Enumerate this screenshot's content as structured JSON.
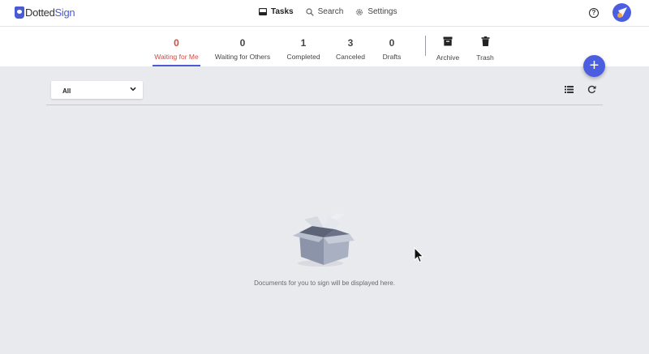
{
  "app": {
    "logo_prefix": "Dotted",
    "logo_suffix": "Sign"
  },
  "topnav": [
    {
      "label": "Tasks",
      "icon": "inbox-icon",
      "active": true
    },
    {
      "label": "Search",
      "icon": "search-icon",
      "active": false
    },
    {
      "label": "Settings",
      "icon": "gear-icon",
      "active": false
    }
  ],
  "header": {
    "help_icon": "help-icon",
    "avatar": "user-avatar"
  },
  "tabs": [
    {
      "count": "0",
      "label": "Waiting for Me",
      "active": true
    },
    {
      "count": "0",
      "label": "Waiting for Others",
      "active": false
    },
    {
      "count": "1",
      "label": "Completed",
      "active": false
    },
    {
      "count": "3",
      "label": "Canceled",
      "active": false
    },
    {
      "count": "0",
      "label": "Drafts",
      "active": false
    },
    {
      "label": "Archive",
      "icon": "archive-icon"
    },
    {
      "label": "Trash",
      "icon": "trash-icon"
    }
  ],
  "fab": {
    "label": "+"
  },
  "filter": {
    "selected": "All"
  },
  "empty_state": {
    "message": "Documents for you to sign will be displayed here."
  },
  "colors": {
    "accent": "#4c5ee0",
    "active_tab": "#d9473b",
    "background": "#e9eaee"
  }
}
